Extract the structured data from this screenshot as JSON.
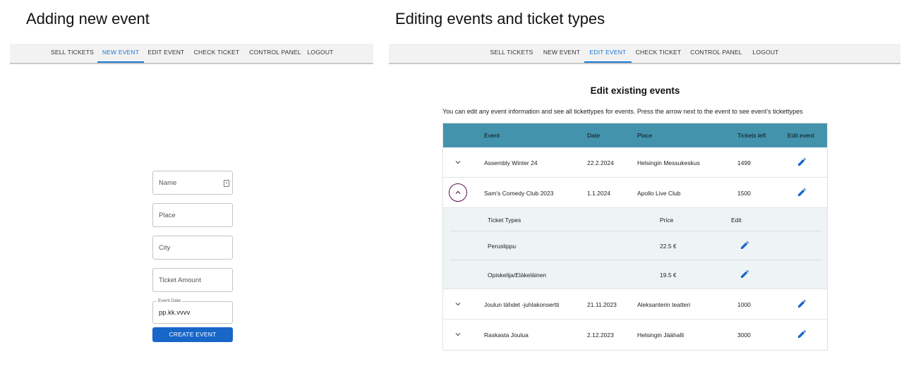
{
  "left_panel": {
    "title": "Adding new event",
    "nav": [
      {
        "label": "SELL TICKETS",
        "active": false
      },
      {
        "label": "NEW EVENT",
        "active": true
      },
      {
        "label": "EDIT EVENT",
        "active": false
      },
      {
        "label": "CHECK TICKET",
        "active": false
      },
      {
        "label": "CONTROL PANEL",
        "active": false
      },
      {
        "label": "LOGOUT",
        "active": false
      }
    ],
    "form": {
      "name_placeholder": "Name",
      "place_placeholder": "Place",
      "city_placeholder": "City",
      "ticket_amount_placeholder": "Ticket Amount",
      "event_date_label": "Event Date",
      "event_date_value": "pp.kk.vvvv",
      "create_button": "CREATE EVENT"
    }
  },
  "right_panel": {
    "title": "Editing events and ticket types",
    "nav": [
      {
        "label": "SELL TICKETS",
        "active": false
      },
      {
        "label": "NEW EVENT",
        "active": false
      },
      {
        "label": "EDIT EVENT",
        "active": true
      },
      {
        "label": "CHECK TICKET",
        "active": false
      },
      {
        "label": "CONTROL PANEL",
        "active": false
      },
      {
        "label": "LOGOUT",
        "active": false
      }
    ],
    "heading": "Edit existing events",
    "description": "You can edit any event information and see all tickettypes for events. Press the arrow next to the event to see event's tickettypes",
    "table": {
      "headers": {
        "event": "Event",
        "date": "Date",
        "place": "Place",
        "tickets_left": "Tickets left",
        "edit_event": "Edit event"
      },
      "rows": [
        {
          "event": "Assembly Winter 24",
          "date": "22.2.2024",
          "place": "Helsingin Messukeskus",
          "tickets_left": "1499",
          "expanded": false
        },
        {
          "event": "Sam's Comedy Club 2023",
          "date": "1.1.2024",
          "place": "Apollo Live Club",
          "tickets_left": "1500",
          "expanded": true
        },
        {
          "event": "Joulun tähdet -juhlakonsertti",
          "date": "21.11.2023",
          "place": "Aleksanterin teatteri",
          "tickets_left": "1000",
          "expanded": false
        },
        {
          "event": "Raskasta Joulua",
          "date": "2.12.2023",
          "place": "Helsingin Jäähalli",
          "tickets_left": "3000",
          "expanded": false
        }
      ],
      "ticket_types": {
        "headers": {
          "type": "Ticket Types",
          "price": "Price",
          "edit": "Edit"
        },
        "rows": [
          {
            "type": "Peruslippu",
            "price": "22.5 €"
          },
          {
            "type": "Opiskelija/Eläkeläinen",
            "price": "19.5 €"
          }
        ]
      }
    }
  },
  "colors": {
    "accent": "#1976d2",
    "table_header": "#4393ad",
    "button": "#1766c8",
    "expanded_chevron_ring": "#5b1150"
  }
}
